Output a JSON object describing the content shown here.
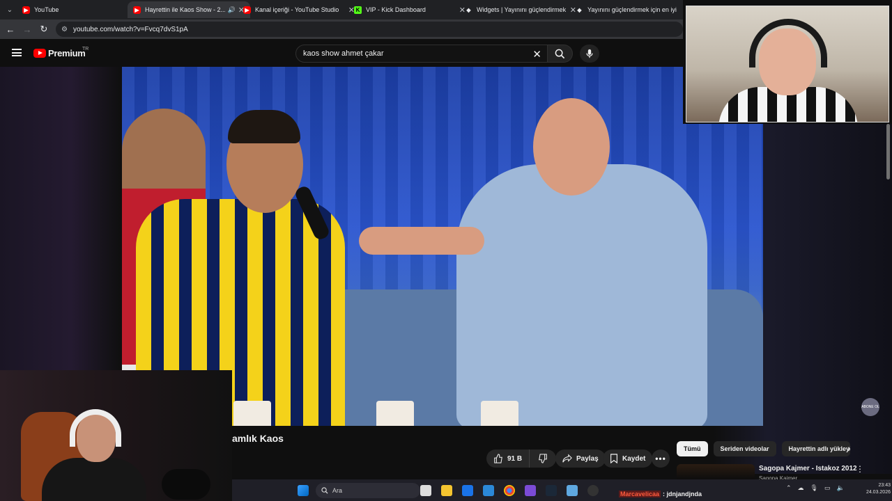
{
  "browser": {
    "tabs": [
      {
        "title": "YouTube",
        "favicon": "youtube",
        "active": false
      },
      {
        "title": "Hayrettin ile Kaos Show - 2...",
        "favicon": "youtube",
        "active": true,
        "audio": true
      },
      {
        "title": "Kanal içeriği - YouTube Studio",
        "favicon": "youtube-studio",
        "active": false
      },
      {
        "title": "VIP - Kick Dashboard",
        "favicon": "kick",
        "active": false
      },
      {
        "title": "Widgets | Yayınını güçlendirmek",
        "favicon": "diamond",
        "active": false
      },
      {
        "title": "Yayınını güçlendirmek için en iyi",
        "favicon": "diamond",
        "active": false
      }
    ],
    "url": "youtube.com/watch?v=Fvcq7dvS1pA"
  },
  "youtube": {
    "brand": "Premium",
    "country_code": "TR",
    "search_query": "kaos show ahmet çakar",
    "video_title_visible": "amlık Kaos",
    "actions": {
      "like_count": "91 B",
      "share_label": "Paylaş",
      "save_label": "Kaydet"
    },
    "chips": [
      "Tümü",
      "Seriden videolar",
      "Hayrettin adlı yükleyic"
    ],
    "recommendation": {
      "title": "Sagopa Kajmer - Istakoz 2012",
      "channel": "Sagopa Kajmer"
    },
    "watermark": "ABONE OL"
  },
  "taskbar": {
    "search_placeholder": "Ara",
    "clock_time": "23:43",
    "clock_date": "24.03.2026"
  },
  "chat_overlay": {
    "username": "Marcavelicaa",
    "message": ": jdnjandjnda"
  },
  "colors": {
    "youtube_red": "#ff0000",
    "kick_green": "#53fc18",
    "page_bg": "#0f0f0f"
  }
}
